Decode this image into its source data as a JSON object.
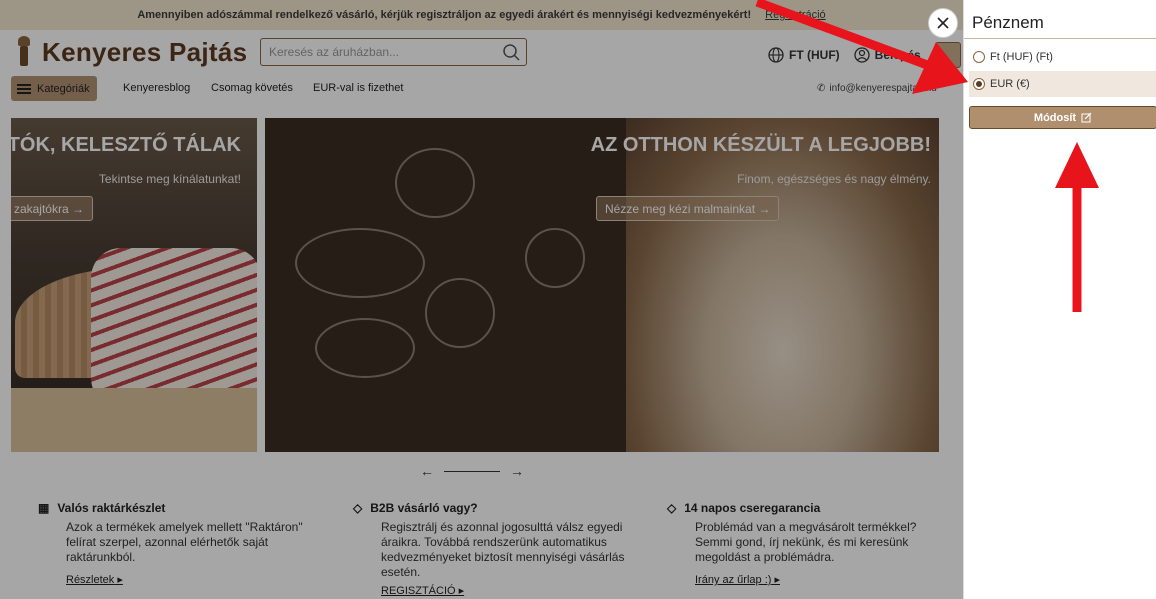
{
  "topbar": {
    "notice": "Amennyiben adószámmal rendelkező vásárló, kérjük regisztráljon az egyedi árakért és mennyiségi kedvezményekért!",
    "register": "Regisztráció"
  },
  "header": {
    "logo": "Kenyeres Pajtás",
    "search_placeholder": "Keresés az áruházban...",
    "currency": "FT (HUF)",
    "login": "Belépés"
  },
  "nav": {
    "categories": "Kategóriák",
    "links": [
      "Kenyeresblog",
      "Csomag követés",
      "EUR-val is fizethet"
    ],
    "email": "info@kenyerespajtas.hu"
  },
  "banners": [
    {
      "title": "ITÓK, KELESZTŐ TÁLAK",
      "subtitle": "Tekintse meg kínálatunkat!",
      "cta": "zakajtókra"
    },
    {
      "title": "AZ OTTHON KÉSZÜLT A LEGJOBB!",
      "subtitle": "Finom, egészséges és nagy élmény.",
      "cta": "Nézze meg kézi malmainkat"
    }
  ],
  "features": [
    {
      "title": "Valós raktárkészlet",
      "desc": "Azok a  termékek amelyek mellett \"Raktáron\" felírat szerpel, azonnal elérhetők saját raktárunkból.",
      "link": "Részletek"
    },
    {
      "title": "B2B vásárló vagy?",
      "desc": "Regisztrálj és azonnal jogosulttá válsz egyedi áraikra. Továbbá rendszerünk automatikus kedvezményeket biztosít mennyiségi vásárlás esetén.",
      "link": "REGISZTÁCIÓ"
    },
    {
      "title": "14 napos cseregarancia",
      "desc": "Problémád van a megvásárolt termékkel? Semmi gond, írj nekünk, és mi keresünk megoldást a problémádra.",
      "link": "Irány az űrlap :)"
    }
  ],
  "panel": {
    "title": "Pénznem",
    "options": [
      {
        "label": "Ft (HUF) (Ft)",
        "selected": false
      },
      {
        "label": "EUR (€)",
        "selected": true
      }
    ],
    "modify": "Módosít"
  },
  "colors": {
    "accent": "#b08f6f",
    "brand": "#5b3a21",
    "annotation": "#e8141c"
  }
}
